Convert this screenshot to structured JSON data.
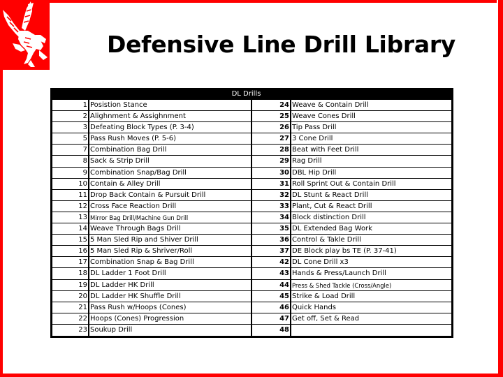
{
  "slide": {
    "title": "Defensive Line Drill Library",
    "accent_color": "#ff0000",
    "logo_icon": "eagle-icon"
  },
  "table": {
    "header": "DL Drills",
    "left": [
      {
        "num": "1",
        "name": "Posistion Stance"
      },
      {
        "num": "2",
        "name": "Alighnment & Assighnment"
      },
      {
        "num": "3",
        "name": "Defeating Block Types (P. 3-4)"
      },
      {
        "num": "5",
        "name": "Pass Rush Moves (P. 5-6)"
      },
      {
        "num": "7",
        "name": "Combination Bag Drill"
      },
      {
        "num": "8",
        "name": "Sack & Strip Drill"
      },
      {
        "num": "9",
        "name": "Combination Snap/Bag Drill"
      },
      {
        "num": "10",
        "name": "Contain & Alley Drill"
      },
      {
        "num": "11",
        "name": "Drop Back Contain & Pursuit Drill"
      },
      {
        "num": "12",
        "name": "Cross Face Reaction Drill"
      },
      {
        "num": "13",
        "name": "Mirror Bag Drill/Machine Gun Drill",
        "small": true
      },
      {
        "num": "14",
        "name": "Weave Through Bags Drill"
      },
      {
        "num": "15",
        "name": "5 Man Sled Rip and Shiver Drill"
      },
      {
        "num": "16",
        "name": "5 Man Sled Rip & Shriver/Roll"
      },
      {
        "num": "17",
        "name": "Combination Snap & Bag Drill"
      },
      {
        "num": "18",
        "name": "DL Ladder 1 Foot Drill"
      },
      {
        "num": "19",
        "name": "DL Ladder HK Drill"
      },
      {
        "num": "20",
        "name": "DL Ladder HK Shuffle Drill"
      },
      {
        "num": "21",
        "name": "Pass Rush w/Hoops (Cones)"
      },
      {
        "num": "22",
        "name": "Hoops (Cones) Progression"
      },
      {
        "num": "23",
        "name": "Soukup Drill"
      }
    ],
    "right": [
      {
        "num": "24",
        "name": "Weave & Contain Drill"
      },
      {
        "num": "25",
        "name": "Weave Cones Drill"
      },
      {
        "num": "26",
        "name": "Tip Pass Drill"
      },
      {
        "num": "27",
        "name": "3 Cone Drill"
      },
      {
        "num": "28",
        "name": "Beat with Feet Drill"
      },
      {
        "num": "29",
        "name": "Rag Drill"
      },
      {
        "num": "30",
        "name": "DBL Hip Drill"
      },
      {
        "num": "31",
        "name": "Roll Sprint Out & Contain Drill"
      },
      {
        "num": "32",
        "name": "DL Stunt & React Drill"
      },
      {
        "num": "33",
        "name": "Plant, Cut & React Drill"
      },
      {
        "num": "34",
        "name": "Block distinction Drill"
      },
      {
        "num": "35",
        "name": "DL Extended Bag Work"
      },
      {
        "num": "36",
        "name": "Control & Takle Drill"
      },
      {
        "num": "37",
        "name": "DE Block play bs TE (P. 37-41)"
      },
      {
        "num": "42",
        "name": "DL Cone Drill x3"
      },
      {
        "num": "43",
        "name": "Hands & Press/Launch Drill"
      },
      {
        "num": "44",
        "name": "Press & Shed Tackle (Cross/Angle)",
        "small": true
      },
      {
        "num": "45",
        "name": " Strike & Load Drill"
      },
      {
        "num": "46",
        "name": " Quick Hands"
      },
      {
        "num": "47",
        "name": " Get off, Set & Read"
      },
      {
        "num": "48",
        "name": ""
      }
    ]
  }
}
